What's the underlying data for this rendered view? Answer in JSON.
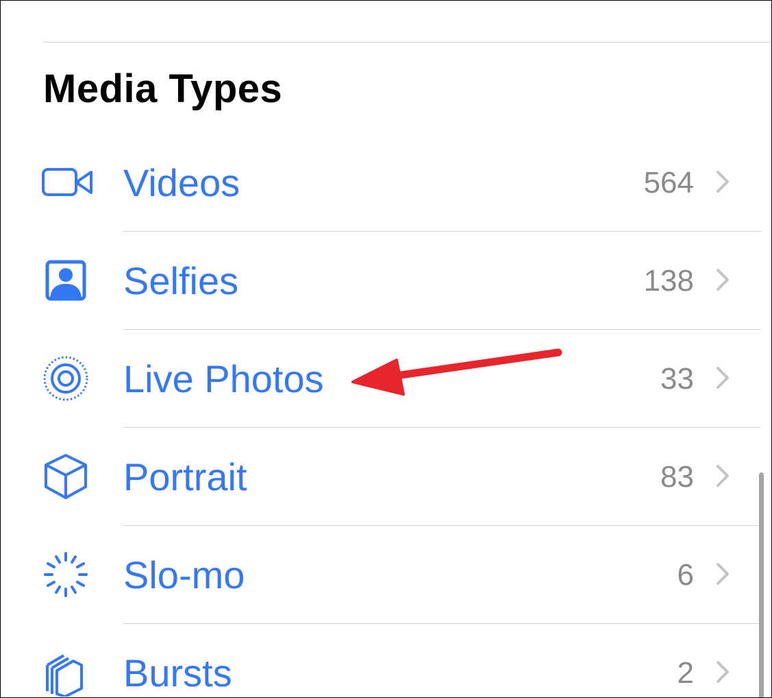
{
  "section": {
    "title": "Media Types"
  },
  "colors": {
    "accent": "#3478f6",
    "count": "#8a8a8e",
    "chevron": "#c4c4c7",
    "divider": "#d1d1d6",
    "annotation_arrow": "#e8252a"
  },
  "items": [
    {
      "label": "Videos",
      "count": "564",
      "icon": "video-camera-icon"
    },
    {
      "label": "Selfies",
      "count": "138",
      "icon": "selfie-portrait-icon"
    },
    {
      "label": "Live Photos",
      "count": "33",
      "icon": "live-photo-icon"
    },
    {
      "label": "Portrait",
      "count": "83",
      "icon": "cube-icon"
    },
    {
      "label": "Slo-mo",
      "count": "6",
      "icon": "slo-mo-icon"
    },
    {
      "label": "Bursts",
      "count": "2",
      "icon": "burst-stack-icon"
    }
  ],
  "annotation": {
    "type": "arrow",
    "points_to": "Live Photos"
  }
}
